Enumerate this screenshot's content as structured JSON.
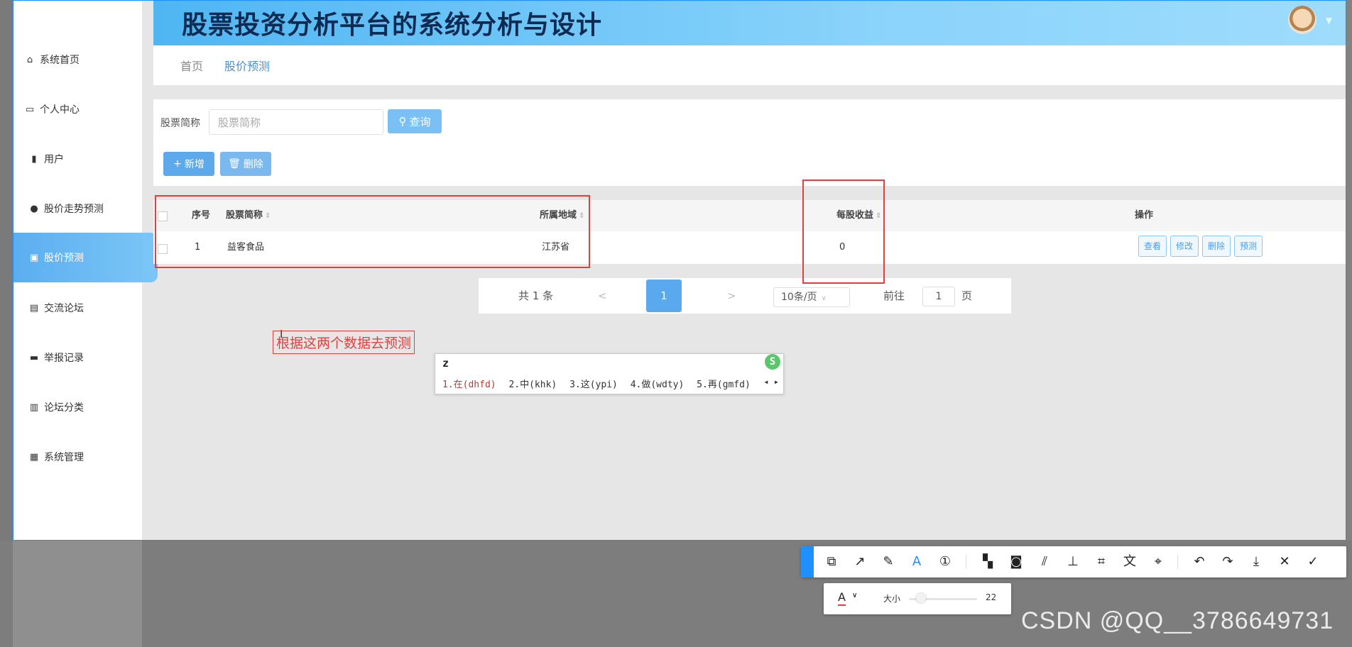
{
  "app": {
    "title": "股票投资分析平台的系统分析与设计"
  },
  "sidebar": {
    "items": [
      {
        "label": "系统首页",
        "icon": "home-icon"
      },
      {
        "label": "个人中心",
        "icon": "card-icon"
      },
      {
        "label": "用户",
        "icon": "book-icon"
      },
      {
        "label": "股价走势预测",
        "icon": "person-icon"
      },
      {
        "label": "股价预测",
        "icon": "briefcase-icon",
        "active": true
      },
      {
        "label": "交流论坛",
        "icon": "clipboard-icon"
      },
      {
        "label": "举报记录",
        "icon": "monitor-icon"
      },
      {
        "label": "论坛分类",
        "icon": "bar-chart-icon"
      },
      {
        "label": "系统管理",
        "icon": "grid-icon"
      }
    ]
  },
  "breadcrumb": {
    "home": "首页",
    "current": "股价预测"
  },
  "filter": {
    "label": "股票简称",
    "placeholder": "股票简称",
    "query_label": "查询",
    "add_label": "新增",
    "delete_label": "删除"
  },
  "table": {
    "columns": [
      "序号",
      "股票简称",
      "所属地域",
      "每股收益",
      "操作"
    ],
    "rows": [
      {
        "index": "1",
        "name": "益客食品",
        "region": "江苏省",
        "eps": "0"
      }
    ],
    "actions": [
      "查看",
      "修改",
      "删除",
      "预测"
    ]
  },
  "pagination": {
    "total": "共 1 条",
    "prev": "<",
    "current_page": "1",
    "next": ">",
    "page_size": "10条/页",
    "goto_prefix": "前往",
    "goto_value": "1",
    "goto_suffix": "页"
  },
  "annotation": {
    "note": "根据这两个数据去预测"
  },
  "ime": {
    "composition": "z",
    "candidates": [
      "1.在(dhfd)",
      "2.中(khk)",
      "3.这(ypi)",
      "4.做(wdty)",
      "5.再(gmfd)"
    ]
  },
  "screenshot_tool": {
    "size_label": "大小",
    "size_value": "22",
    "tools": [
      "shape-icon",
      "arrow-icon",
      "pencil-icon",
      "text-icon",
      "number-icon",
      "mosaic-icon",
      "circle-fill-icon",
      "hatch-icon",
      "pin-icon",
      "ocr-icon",
      "translate-icon",
      "scan-icon",
      "undo-icon",
      "redo-icon",
      "download-icon",
      "close-icon",
      "check-icon"
    ],
    "accent_color": "#1e90ff",
    "text_color": "#e53e3e"
  },
  "watermark": "CSDN @QQ__3786649731",
  "colors": {
    "header_gradient_start": "#4fb6f2",
    "active_nav": "#5aaef0",
    "primary_button": "#5ca9ec",
    "annotation_red": "#e53e3e"
  }
}
